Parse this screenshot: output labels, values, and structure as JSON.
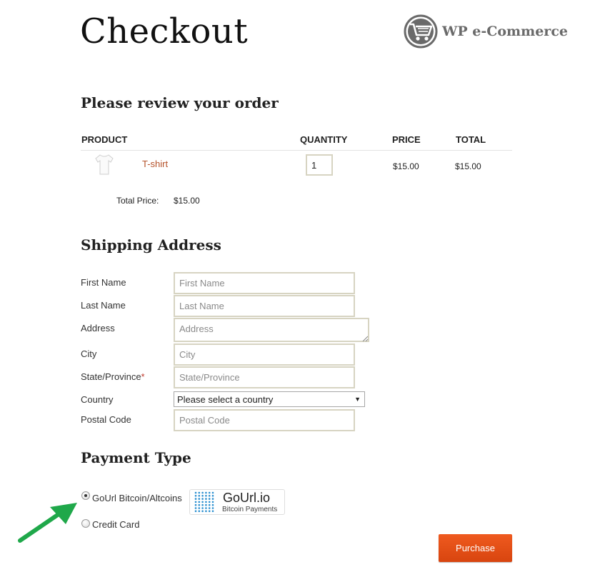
{
  "page": {
    "title": "Checkout"
  },
  "brand": {
    "name": "WP e-Commerce",
    "icon": "shopping-cart-icon",
    "color": "#6a6a6a"
  },
  "review": {
    "heading": "Please review your order",
    "columns": {
      "product": "PRODUCT",
      "quantity": "QUANTITY",
      "price": "PRICE",
      "total": "TOTAL"
    },
    "items": [
      {
        "name": "T-shirt",
        "quantity": "1",
        "price": "$15.00",
        "total": "$15.00",
        "icon": "tshirt-thumbnail"
      }
    ],
    "total_label": "Total Price:",
    "total_value": "$15.00"
  },
  "shipping": {
    "heading": "Shipping Address",
    "fields": {
      "first_name": {
        "label": "First Name",
        "placeholder": "First Name"
      },
      "last_name": {
        "label": "Last Name",
        "placeholder": "Last Name"
      },
      "address": {
        "label": "Address",
        "placeholder": "Address"
      },
      "city": {
        "label": "City",
        "placeholder": "City"
      },
      "state": {
        "label": "State/Province",
        "required_mark": "*",
        "placeholder": "State/Province"
      },
      "country": {
        "label": "Country",
        "selected": "Please select a country"
      },
      "postal": {
        "label": "Postal Code",
        "placeholder": "Postal Code"
      }
    }
  },
  "payment": {
    "heading": "Payment Type",
    "options": [
      {
        "label": "GoUrl Bitcoin/Altcoins",
        "selected": true
      },
      {
        "label": "Credit Card",
        "selected": false
      }
    ],
    "gourl_badge": {
      "name": "GoUrl.io",
      "tagline": "Bitcoin Payments",
      "dot_color": "#2a8fd0"
    }
  },
  "actions": {
    "purchase_label": "Purchase",
    "color": "#e04e15"
  },
  "annotation": {
    "arrow_color": "#1fa84a"
  }
}
